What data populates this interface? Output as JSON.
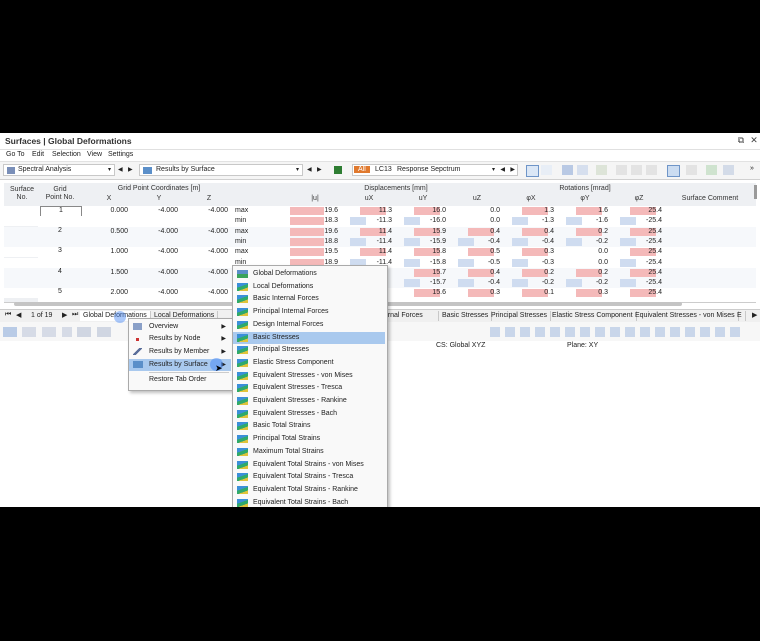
{
  "window": {
    "title": "Surfaces | Global Deformations",
    "pin": "⧉",
    "close": "✕"
  },
  "menu": [
    "Go To",
    "Edit",
    "Selection",
    "View",
    "Settings"
  ],
  "toolbar": {
    "analysis_combo": "Spectral Analysis",
    "results_combo": "Results by Surface",
    "lc_badge": "All",
    "lc_code": "LC13",
    "lc_name": "Response Sepctrum"
  },
  "table": {
    "headers": {
      "surface_no": "Surface\nNo.",
      "grid_point_no": "Grid\nPoint No.",
      "grid_coords": "Grid Point Coordinates [m]",
      "x": "X",
      "y": "Y",
      "z": "Z",
      "displacements": "Displacements [mm]",
      "u": "|u|",
      "ux": "uX",
      "uy": "uY",
      "uz": "uZ",
      "rotations": "Rotations [mrad]",
      "phix": "φX",
      "phiy": "φY",
      "phiz": "φZ",
      "comment": "Surface Comment"
    },
    "surface": "1",
    "rows": [
      {
        "gp": "1",
        "x": "0.000",
        "y": "-4.000",
        "z": "-4.000",
        "type": "max",
        "u": "19.6",
        "ux": "11.3",
        "uy": "16.0",
        "uz": "0.0",
        "px": "1.3",
        "py": "1.6",
        "pz": "25.4"
      },
      {
        "gp": "",
        "x": "",
        "y": "",
        "z": "",
        "type": "min",
        "u": "18.3",
        "ux": "-11.3",
        "uy": "-16.0",
        "uz": "0.0",
        "px": "-1.3",
        "py": "-1.6",
        "pz": "-25.4"
      },
      {
        "gp": "2",
        "x": "0.500",
        "y": "-4.000",
        "z": "-4.000",
        "type": "max",
        "u": "19.6",
        "ux": "11.4",
        "uy": "15.9",
        "uz": "0.4",
        "px": "0.4",
        "py": "0.2",
        "pz": "25.4"
      },
      {
        "gp": "",
        "x": "",
        "y": "",
        "z": "",
        "type": "min",
        "u": "18.8",
        "ux": "-11.4",
        "uy": "-15.9",
        "uz": "-0.4",
        "px": "-0.4",
        "py": "-0.2",
        "pz": "-25.4"
      },
      {
        "gp": "3",
        "x": "1.000",
        "y": "-4.000",
        "z": "-4.000",
        "type": "max",
        "u": "19.5",
        "ux": "11.4",
        "uy": "15.8",
        "uz": "0.5",
        "px": "0.3",
        "py": "0.0",
        "pz": "25.4"
      },
      {
        "gp": "",
        "x": "",
        "y": "",
        "z": "",
        "type": "min",
        "u": "18.9",
        "ux": "-11.4",
        "uy": "-15.8",
        "uz": "-0.5",
        "px": "-0.3",
        "py": "0.0",
        "pz": "-25.4"
      },
      {
        "gp": "4",
        "x": "1.500",
        "y": "-4.000",
        "z": "-4.000",
        "type": "max",
        "u": "",
        "ux": "",
        "uy": "15.7",
        "uz": "0.4",
        "px": "0.2",
        "py": "0.2",
        "pz": "25.4"
      },
      {
        "gp": "",
        "x": "",
        "y": "",
        "z": "",
        "type": "min",
        "u": "",
        "ux": "",
        "uy": "-15.7",
        "uz": "-0.4",
        "px": "-0.2",
        "py": "-0.2",
        "pz": "-25.4"
      },
      {
        "gp": "5",
        "x": "2.000",
        "y": "-4.000",
        "z": "-4.000",
        "type": "max",
        "u": "",
        "ux": "",
        "uy": "15.6",
        "uz": "0.3",
        "px": "0.1",
        "py": "0.3",
        "pz": "25.4"
      }
    ]
  },
  "tabs": {
    "pager": "1 of 19",
    "items": [
      "Global Deformations",
      "Local Deformations",
      "Basic Internal Forces",
      "Principal Internal Forces",
      "Design Internal Forces",
      "Basic Stresses",
      "Principal Stresses",
      "Elastic Stress Component",
      "Equivalent Stresses - von Mises",
      "E"
    ]
  },
  "status": {
    "cs": "CS: Global XYZ",
    "plane": "Plane: XY"
  },
  "context_menu": [
    "Overview",
    "Results by Node",
    "Results by Member",
    "Results by Surface",
    "Restore Tab Order"
  ],
  "submenu": [
    "Global Deformations",
    "Local Deformations",
    "Basic Internal Forces",
    "Principal Internal Forces",
    "Design Internal Forces",
    "Basic Stresses",
    "Principal Stresses",
    "Elastic Stress Component",
    "Equivalent Stresses - von Mises",
    "Equivalent Stresses - Tresca",
    "Equivalent Stresses - Rankine",
    "Equivalent Stresses - Bach",
    "Basic Total Strains",
    "Principal Total Strains",
    "Maximum Total Strains",
    "Equivalent Total Strains - von Mises",
    "Equivalent Total Strains - Tresca",
    "Equivalent Total Strains - Rankine",
    "Equivalent Total Strains - Bach"
  ]
}
